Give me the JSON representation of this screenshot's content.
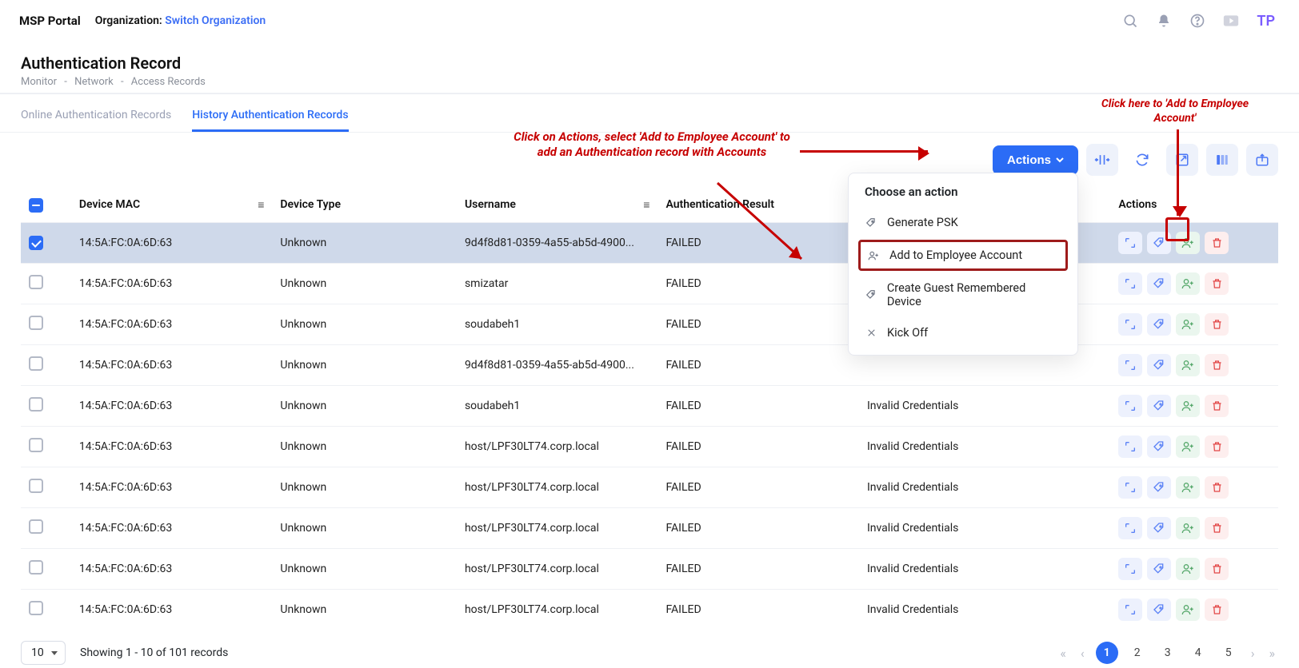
{
  "topbar": {
    "portal": "MSP Portal",
    "org_label": "Organization:",
    "switch": "Switch Organization",
    "avatar": "TP"
  },
  "header": {
    "title": "Authentication Record",
    "crumbs": [
      "Monitor",
      "Network",
      "Access Records"
    ]
  },
  "tabs": {
    "online": "Online Authentication Records",
    "history": "History Authentication Records"
  },
  "toolbar": {
    "actions": "Actions"
  },
  "dropdown": {
    "title": "Choose an action",
    "items": [
      "Generate PSK",
      "Add to Employee Account",
      "Create Guest Remembered Device",
      "Kick Off"
    ]
  },
  "annotations": {
    "main": "Click on Actions, select 'Add to Employee Account' to add an Authentication record with Accounts",
    "right": "Click here to 'Add to Employee Account'"
  },
  "table": {
    "cols": {
      "mac": "Device MAC",
      "type": "Device Type",
      "user": "Username",
      "result": "Authentication Result",
      "actions": "Actions"
    },
    "rows": [
      {
        "mac": "14:5A:FC:0A:6D:63",
        "type": "Unknown",
        "user": "9d4f8d81-0359-4a55-ab5d-4900...",
        "result": "FAILED",
        "reason": ""
      },
      {
        "mac": "14:5A:FC:0A:6D:63",
        "type": "Unknown",
        "user": "smizatar",
        "result": "FAILED",
        "reason": ""
      },
      {
        "mac": "14:5A:FC:0A:6D:63",
        "type": "Unknown",
        "user": "soudabeh1",
        "result": "FAILED",
        "reason": ""
      },
      {
        "mac": "14:5A:FC:0A:6D:63",
        "type": "Unknown",
        "user": "9d4f8d81-0359-4a55-ab5d-4900...",
        "result": "FAILED",
        "reason": ""
      },
      {
        "mac": "14:5A:FC:0A:6D:63",
        "type": "Unknown",
        "user": "soudabeh1",
        "result": "FAILED",
        "reason": "Invalid Credentials"
      },
      {
        "mac": "14:5A:FC:0A:6D:63",
        "type": "Unknown",
        "user": "host/LPF30LT74.corp.local",
        "result": "FAILED",
        "reason": "Invalid Credentials"
      },
      {
        "mac": "14:5A:FC:0A:6D:63",
        "type": "Unknown",
        "user": "host/LPF30LT74.corp.local",
        "result": "FAILED",
        "reason": "Invalid Credentials"
      },
      {
        "mac": "14:5A:FC:0A:6D:63",
        "type": "Unknown",
        "user": "host/LPF30LT74.corp.local",
        "result": "FAILED",
        "reason": "Invalid Credentials"
      },
      {
        "mac": "14:5A:FC:0A:6D:63",
        "type": "Unknown",
        "user": "host/LPF30LT74.corp.local",
        "result": "FAILED",
        "reason": "Invalid Credentials"
      },
      {
        "mac": "14:5A:FC:0A:6D:63",
        "type": "Unknown",
        "user": "host/LPF30LT74.corp.local",
        "result": "FAILED",
        "reason": "Invalid Credentials"
      }
    ]
  },
  "footer": {
    "page_size": "10",
    "summary": "Showing 1 - 10 of 101 records",
    "pages": [
      "1",
      "2",
      "3",
      "4",
      "5"
    ]
  }
}
